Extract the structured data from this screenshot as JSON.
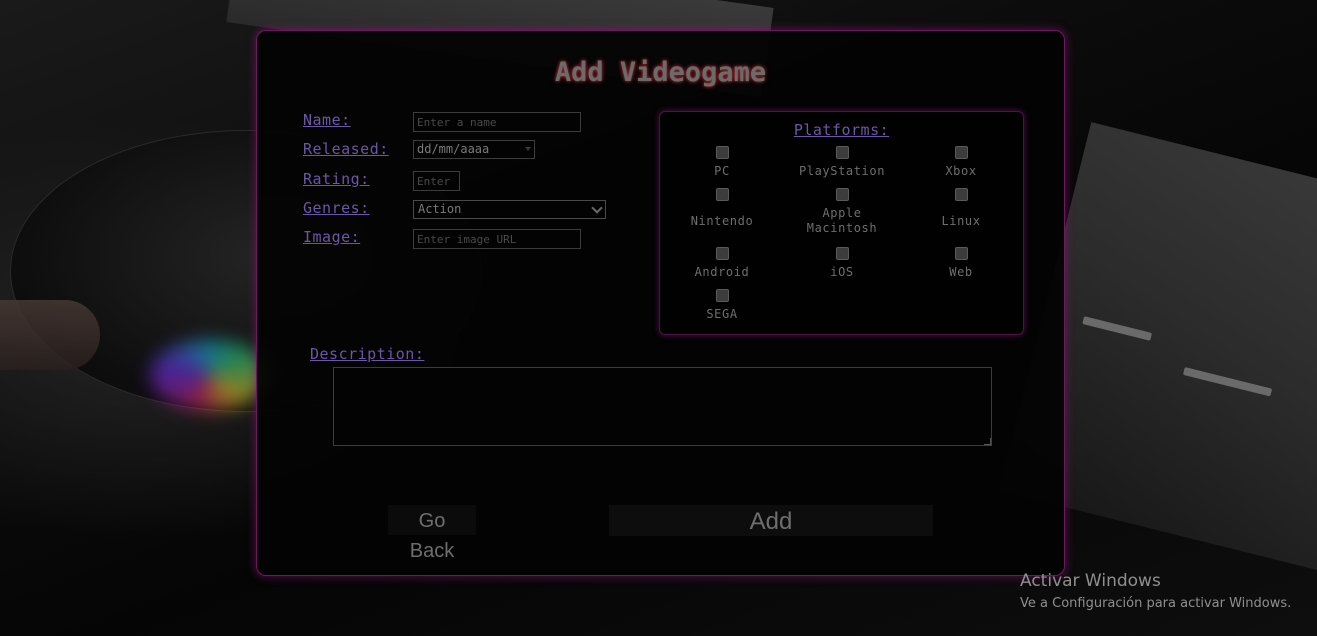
{
  "form": {
    "title": "Add Videogame",
    "fields": {
      "name_label": "Name:",
      "name_placeholder": "Enter a name",
      "released_label": "Released:",
      "released_value": "dd/mm/aaaa",
      "rating_label": "Rating:",
      "rating_placeholder": "Enter",
      "genres_label": "Genres:",
      "genres_selected": "Action",
      "image_label": "Image:",
      "image_placeholder": "Enter image URL"
    },
    "platforms": {
      "title": "Platforms:",
      "items": [
        {
          "label": "PC",
          "checked": false
        },
        {
          "label": "PlayStation",
          "checked": false
        },
        {
          "label": "Xbox",
          "checked": false
        },
        {
          "label": "Nintendo",
          "checked": false
        },
        {
          "label": "Apple Macintosh",
          "checked": false
        },
        {
          "label": "Linux",
          "checked": false
        },
        {
          "label": "Android",
          "checked": false
        },
        {
          "label": "iOS",
          "checked": false
        },
        {
          "label": "Web",
          "checked": false
        },
        {
          "label": "SEGA",
          "checked": false
        }
      ]
    },
    "description_label": "Description:",
    "buttons": {
      "back_label": "Go Back",
      "add_label": "Add"
    }
  },
  "watermark": {
    "title": "Activar Windows",
    "subtitle": "Ve a Configuración para activar Windows."
  },
  "colors": {
    "label_purple": "#6c56a6",
    "panel_glow": "#8c1478",
    "title_glow": "#dc3c3c"
  }
}
